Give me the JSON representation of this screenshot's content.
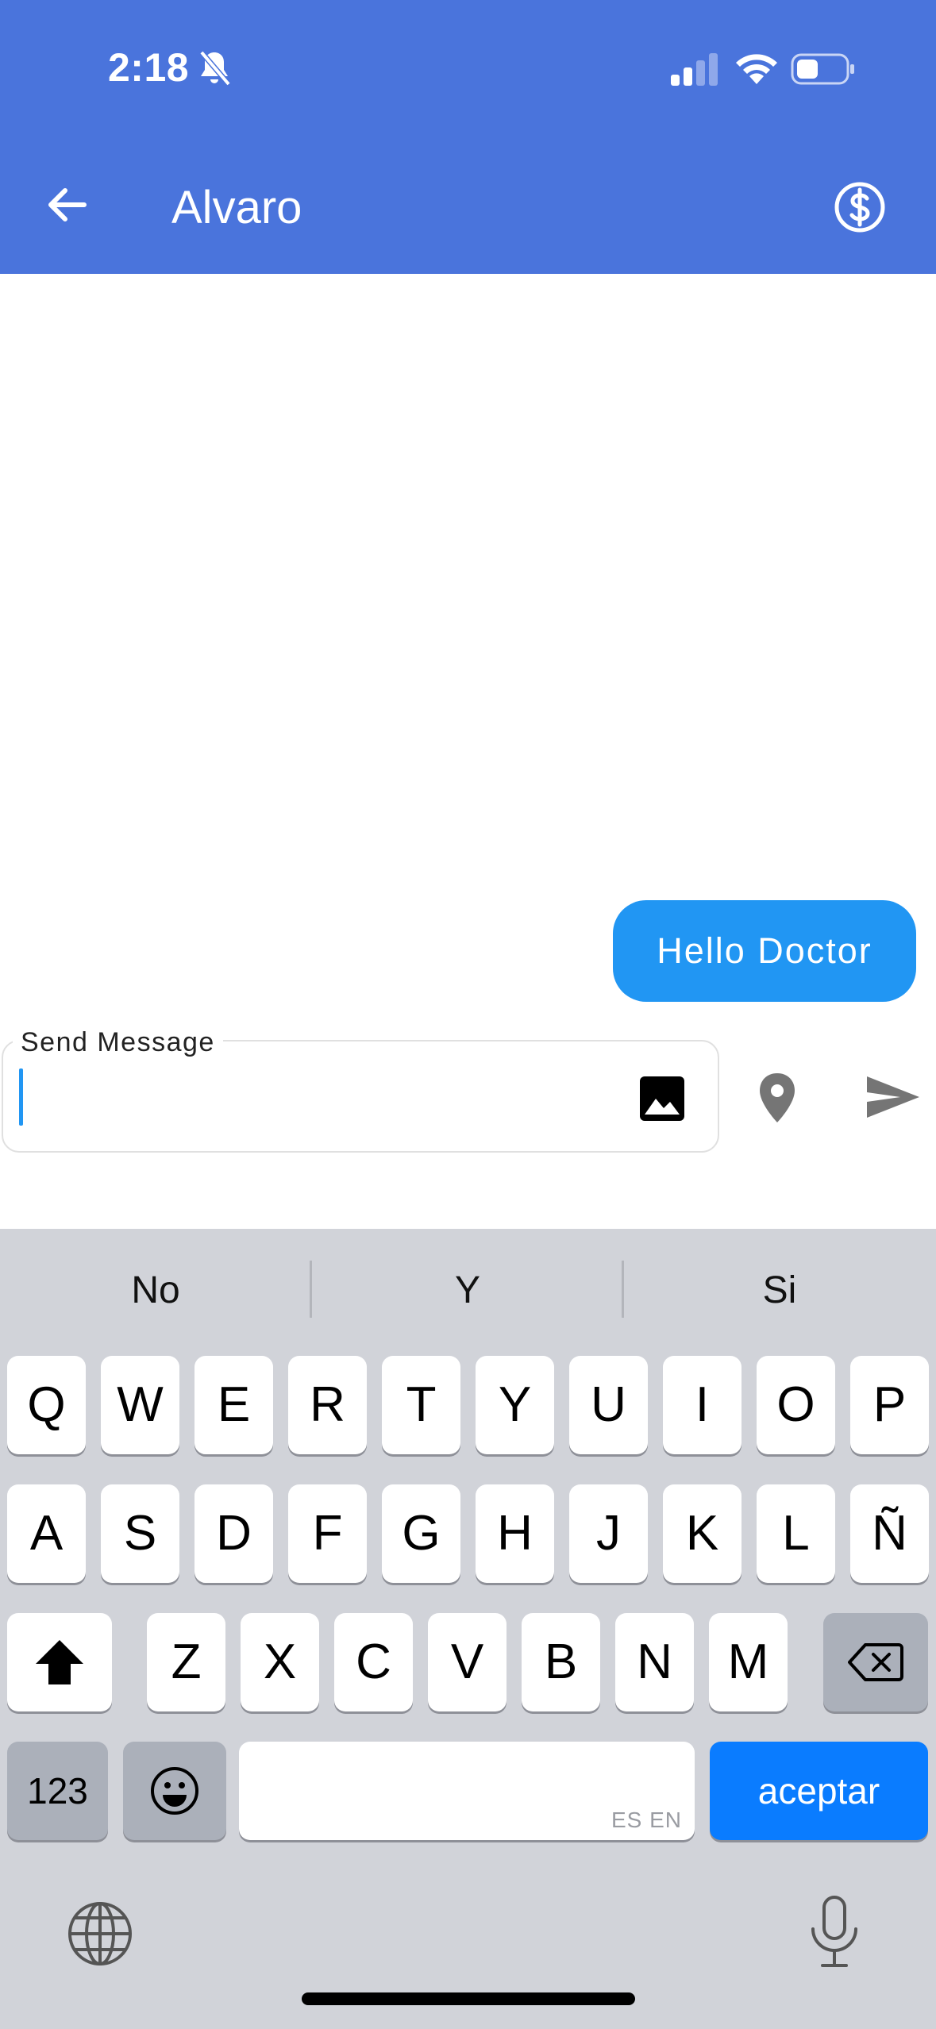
{
  "status_bar": {
    "time": "2:18"
  },
  "header": {
    "title": "Alvaro"
  },
  "messages": [
    {
      "text": "Hello Doctor",
      "sender": "me"
    }
  ],
  "composer": {
    "label": "Send Message",
    "value": ""
  },
  "keyboard": {
    "suggestions": [
      "No",
      "Y",
      "Si"
    ],
    "row1": [
      "Q",
      "W",
      "E",
      "R",
      "T",
      "Y",
      "U",
      "I",
      "O",
      "P"
    ],
    "row2": [
      "A",
      "S",
      "D",
      "F",
      "G",
      "H",
      "J",
      "K",
      "L",
      "Ñ"
    ],
    "row3": [
      "Z",
      "X",
      "C",
      "V",
      "B",
      "N",
      "M"
    ],
    "numbers_label": "123",
    "return_label": "aceptar",
    "space_hint": "ES EN"
  },
  "colors": {
    "header": "#4a74dc",
    "bubble": "#2196f3",
    "return_key": "#0a7cff",
    "keyboard_bg": "#d1d3d9"
  }
}
